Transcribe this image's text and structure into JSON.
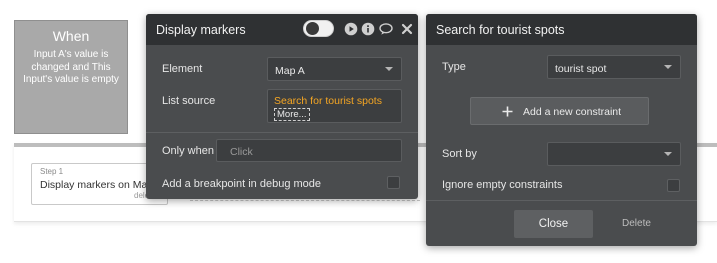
{
  "trigger": {
    "title": "When",
    "description": "Input A's value is changed and This Input's value is empty"
  },
  "workflow": {
    "step_number": "Step 1",
    "step_title": "Display markers on Map A",
    "step_delete": "delete"
  },
  "display_markers": {
    "title": "Display markers",
    "element_label": "Element",
    "element_value": "Map A",
    "list_source_label": "List source",
    "list_source_value": "Search for tourist spots",
    "list_source_more": "More...",
    "only_when_label": "Only when",
    "only_when_placeholder": "Click",
    "breakpoint_label": "Add a breakpoint in debug mode",
    "icons": [
      "toggle-icon",
      "play-icon",
      "info-icon",
      "comment-icon",
      "close-icon"
    ]
  },
  "search": {
    "title": "Search for tourist spots",
    "type_label": "Type",
    "type_value": "tourist spot",
    "add_constraint_label": "Add a new constraint",
    "sort_by_label": "Sort by",
    "sort_by_value": "",
    "ignore_empty_label": "Ignore empty constraints",
    "close_label": "Close",
    "delete_label": "Delete"
  },
  "colors": {
    "panel_bg": "#4a4c4e",
    "panel_header": "#2f3133",
    "accent_orange": "#f5a623"
  }
}
